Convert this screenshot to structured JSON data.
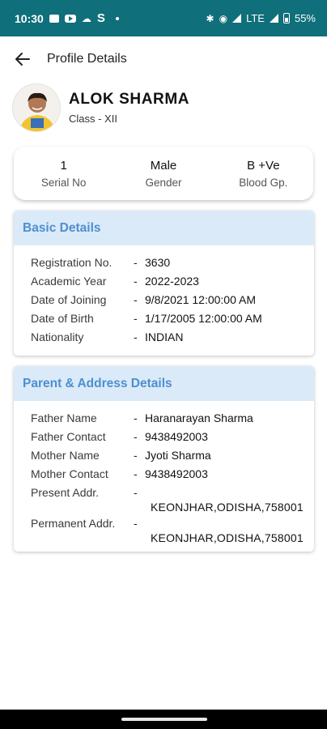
{
  "status_bar": {
    "time": "10:30",
    "s_icon": "S",
    "network": "LTE",
    "battery": "55%"
  },
  "app_bar": {
    "title": "Profile Details",
    "back_icon": "arrow-left-icon"
  },
  "profile": {
    "name": "ALOK SHARMA",
    "class": "Class - XII"
  },
  "summary": [
    {
      "value": "1",
      "label": "Serial No"
    },
    {
      "value": "Male",
      "label": "Gender"
    },
    {
      "value": "B +Ve",
      "label": "Blood Gp."
    }
  ],
  "basic_details": {
    "title": "Basic Details",
    "separator": "-",
    "rows": [
      {
        "label": "Registration No.",
        "value": "3630"
      },
      {
        "label": "Academic Year",
        "value": "2022-2023"
      },
      {
        "label": "Date of Joining",
        "value": "9/8/2021 12:00:00 AM"
      },
      {
        "label": "Date of Birth",
        "value": "1/17/2005 12:00:00 AM"
      },
      {
        "label": "Nationality",
        "value": "INDIAN"
      }
    ]
  },
  "parent_details": {
    "title": "Parent & Address Details",
    "separator": "-",
    "rows": [
      {
        "label": "Father Name",
        "value": "Haranarayan Sharma"
      },
      {
        "label": "Father Contact",
        "value": "9438492003"
      },
      {
        "label": "Mother Name",
        "value": "Jyoti Sharma"
      },
      {
        "label": "Mother Contact",
        "value": "9438492003"
      }
    ],
    "address_rows": [
      {
        "label": "Present Addr.",
        "value": "KEONJHAR,ODISHA,758001"
      },
      {
        "label": "Permanent Addr.",
        "value": "KEONJHAR,ODISHA,758001"
      }
    ]
  },
  "colors": {
    "status_bar": "#0f6f7a",
    "section_header_bg": "#dbeaf8",
    "section_title": "#4d8fd0"
  }
}
